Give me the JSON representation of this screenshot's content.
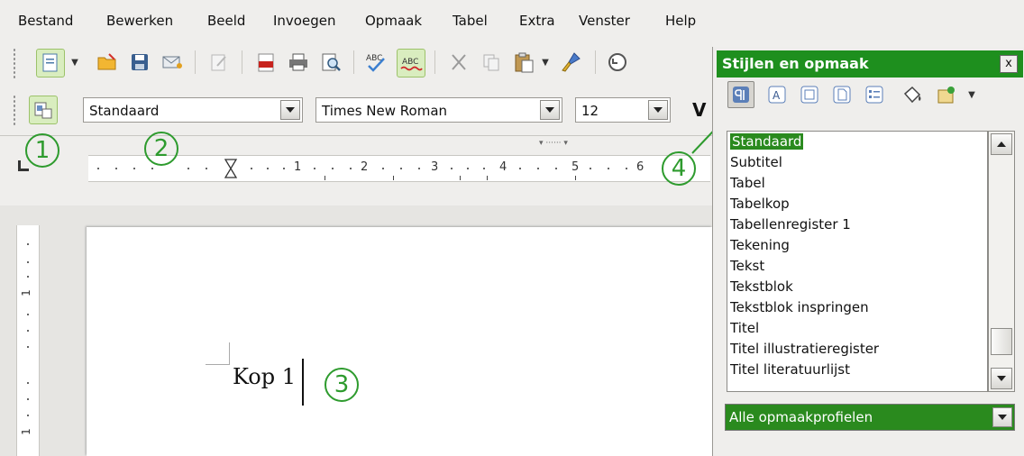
{
  "menu": [
    "Bestand",
    "Bewerken",
    "Beeld",
    "Invoegen",
    "Opmaak",
    "Tabel",
    "Extra",
    "Venster",
    "Help"
  ],
  "formatting": {
    "style_value": "Standaard",
    "font_value": "Times New Roman",
    "size_value": "12",
    "bold_partial": "V"
  },
  "ruler": {
    "numbers": [
      "1",
      "2",
      "3",
      "4",
      "5",
      "6"
    ]
  },
  "vruler": {
    "numbers": [
      "1",
      "1"
    ]
  },
  "document": {
    "text": "Kop 1"
  },
  "callouts": [
    "1",
    "2",
    "3",
    "4"
  ],
  "styles_panel": {
    "title": "Stijlen en opmaak",
    "close": "x",
    "items": [
      "Standaard",
      "Subtitel",
      "Tabel",
      "Tabelkop",
      "Tabellenregister 1",
      "Tekening",
      "Tekst",
      "Tekstblok",
      "Tekstblok inspringen",
      "Titel",
      "Titel illustratieregister",
      "Titel literatuurlijst"
    ],
    "selected_index": 0,
    "filter_value": "Alle opmaakprofielen"
  },
  "colors": {
    "accent_green": "#2e9b2e",
    "panel_title": "#1e8f1e",
    "selection": "#2a8a1e"
  }
}
